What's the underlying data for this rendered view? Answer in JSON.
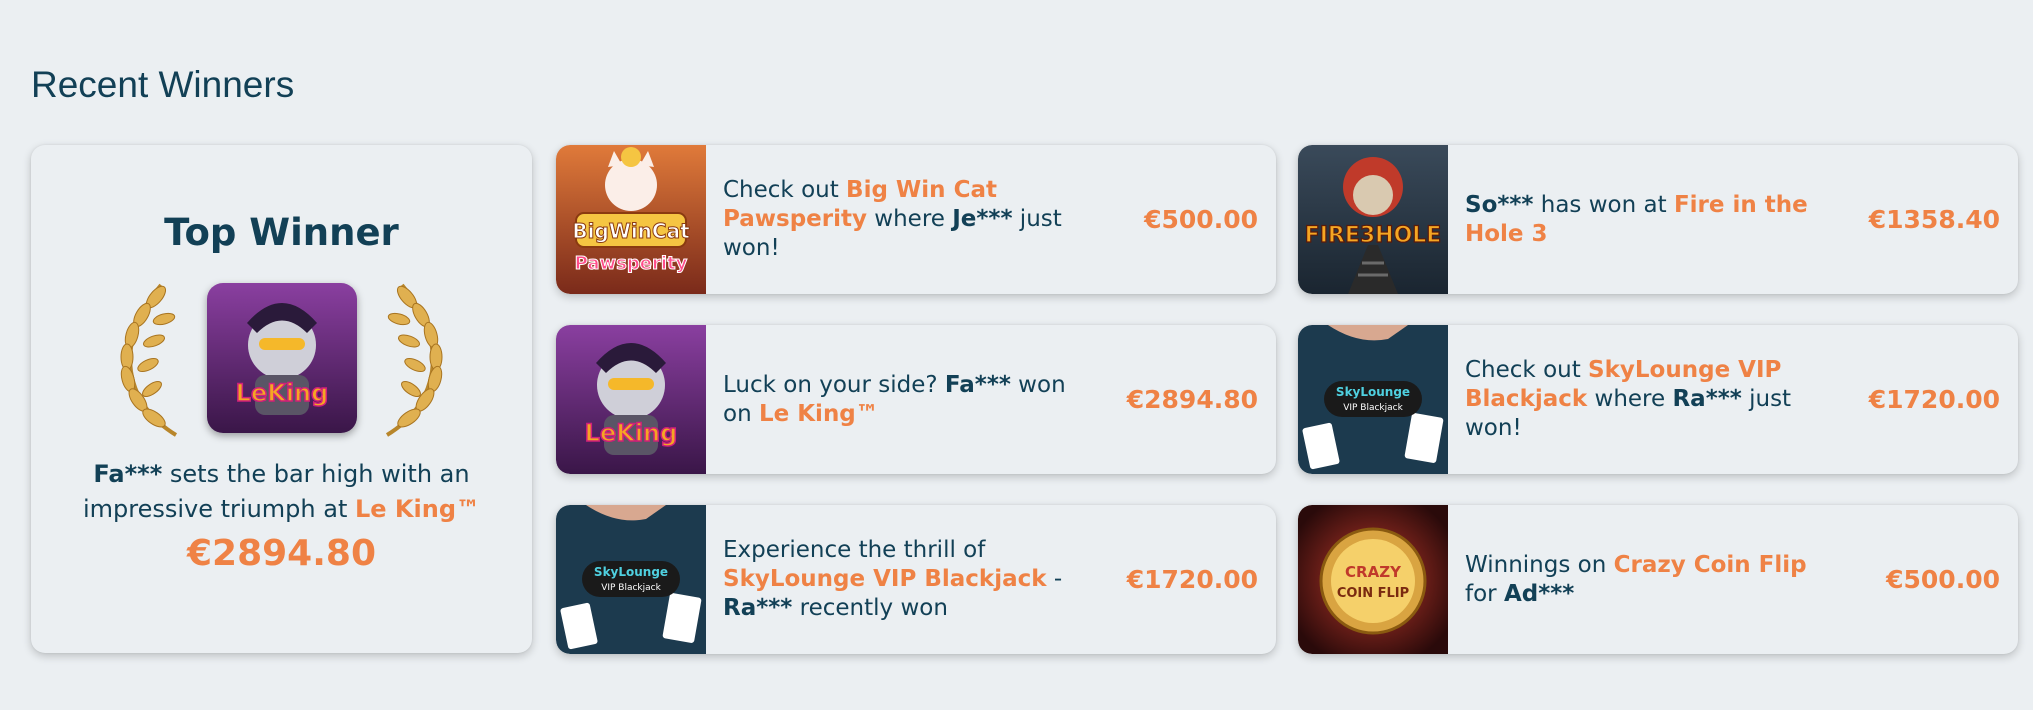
{
  "section": {
    "title": "Recent Winners"
  },
  "top_winner": {
    "heading": "Top Winner",
    "user": "Fa***",
    "text_mid": " sets the bar high with an impressive triumph at ",
    "game": "Le King™",
    "amount": "€2894.80",
    "thumb_label": "LeKing"
  },
  "winners": [
    {
      "pre": "Check out ",
      "game": "Big Win Cat Pawsperity",
      "mid": " where ",
      "user": "Je***",
      "post": " just won!",
      "amount": "€500.00",
      "thumb_label_1": "BigWinCat",
      "thumb_label_2": "Pawsperity"
    },
    {
      "pre": "",
      "user": "So***",
      "mid": " has won at ",
      "game": "Fire in the Hole 3",
      "post": "",
      "amount": "€1358.40",
      "thumb_label_1": "FIRE3HOLE"
    },
    {
      "pre": "Luck on your side? ",
      "user": "Fa***",
      "mid": " won on ",
      "game": "Le King™",
      "post": "",
      "amount": "€2894.80",
      "thumb_label_1": "LeKing"
    },
    {
      "pre": "Check out ",
      "game": "SkyLounge VIP Blackjack",
      "mid": " where ",
      "user": "Ra***",
      "post": " just won!",
      "amount": "€1720.00",
      "thumb_label_1": "SkyLounge",
      "thumb_label_2": "VIP Blackjack"
    },
    {
      "pre": "Experience the thrill of ",
      "game": "SkyLounge VIP Blackjack",
      "mid": " - ",
      "user": "Ra***",
      "post": " recently won",
      "amount": "€1720.00",
      "thumb_label_1": "SkyLounge",
      "thumb_label_2": "VIP Blackjack"
    },
    {
      "pre": "Winnings on ",
      "game": "Crazy Coin Flip",
      "mid": " for ",
      "user": "Ad***",
      "post": "",
      "amount": "€500.00",
      "thumb_label_1": "CRAZY",
      "thumb_label_2": "COIN FLIP"
    }
  ],
  "colors": {
    "accent": "#ef8245",
    "text": "#124056",
    "background": "#ebeff2"
  }
}
